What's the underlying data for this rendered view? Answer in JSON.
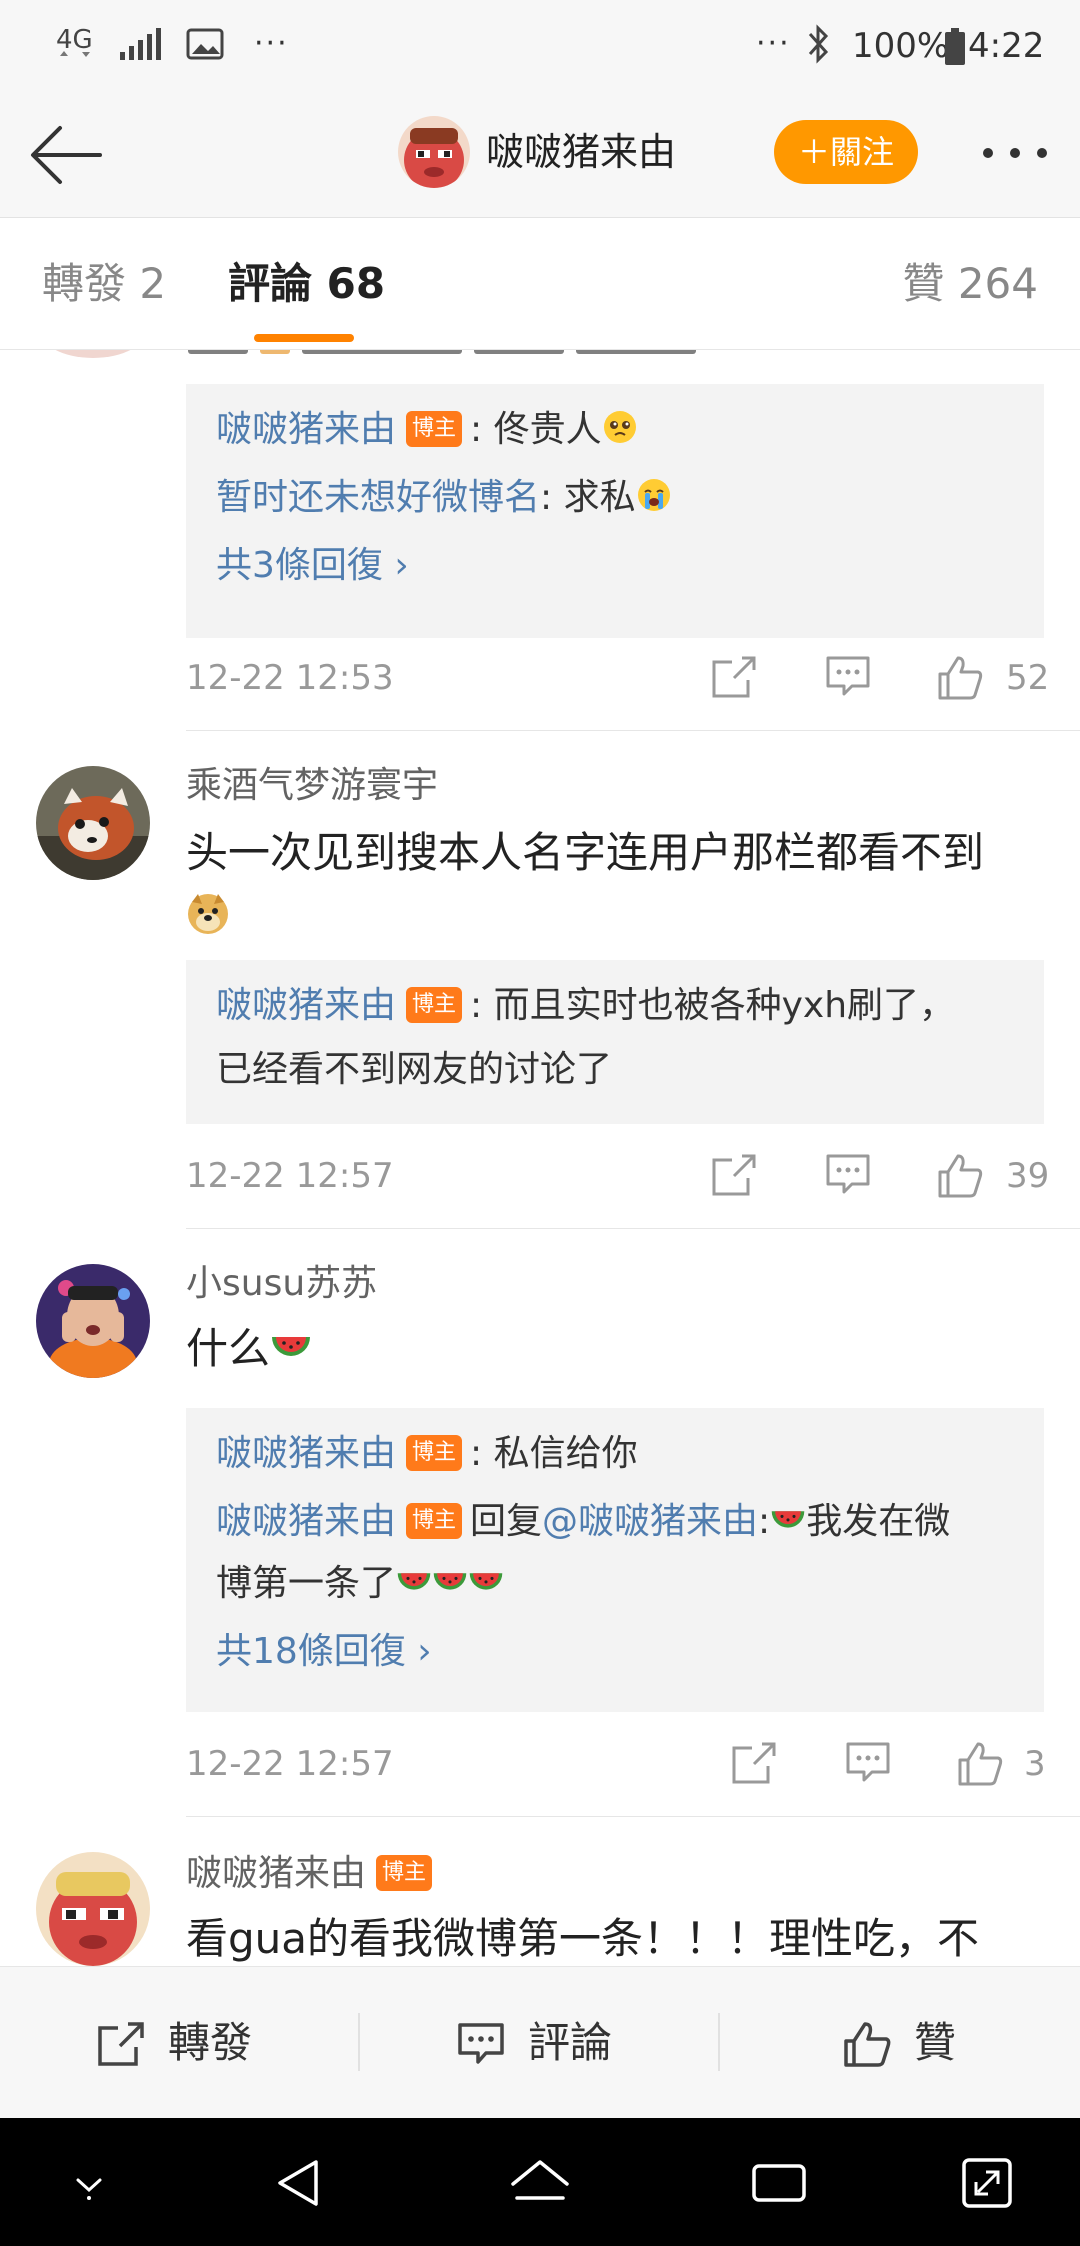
{
  "status_bar": {
    "network": "4G",
    "dots_left": "···",
    "dots_right": "···",
    "battery": "100%",
    "time": "4:22"
  },
  "header": {
    "name": "啵啵猪来由",
    "follow_label": "＋關注"
  },
  "tabs": {
    "repost": "轉發 2",
    "comment": "評論 68",
    "like": "贊 264"
  },
  "comments": [
    {
      "replies": [
        {
          "user": "啵啵猪来由",
          "badge": "博主",
          "text": ": 佟贵人"
        },
        {
          "user": "暂时还未想好微博名",
          "text": ": 求私"
        }
      ],
      "more_replies": "共3條回復",
      "time": "12-22 12:53",
      "likes": "52"
    },
    {
      "user": "乘酒气梦游寰宇",
      "text_line1": "头一次见到搜本人名字连用户那栏都看不到",
      "reply_user": "啵啵猪来由",
      "reply_badge": "博主",
      "reply_line1": ": 而且实时也被各种yxh刷了，",
      "reply_line2": "已经看不到网友的讨论了",
      "time": "12-22 12:57",
      "likes": "39"
    },
    {
      "user": "小susu苏苏",
      "text": "什么",
      "reply1_user": "啵啵猪来由",
      "reply1_badge": "博主",
      "reply1_text": ": 私信给你",
      "reply2_user": "啵啵猪来由",
      "reply2_badge": "博主",
      "reply2_prefix": "回复",
      "reply2_mention": "@啵啵猪来由",
      "reply2_text_a": ":",
      "reply2_text_b": "我发在微",
      "reply2_line2": "博第一条了",
      "more_replies": "共18條回復",
      "time": "12-22 12:57",
      "likes": "3"
    },
    {
      "user": "啵啵猪来由",
      "badge": "博主",
      "text": "看gua的看我微博第一条！！！理性吃，不"
    }
  ],
  "bottom_bar": {
    "repost": "轉發",
    "comment": "評論",
    "like": "贊"
  },
  "colors": {
    "accent": "#ff8200",
    "follow_bg": "#ff9800",
    "username_link": "#507daf",
    "badge": "#ff7a1a"
  }
}
